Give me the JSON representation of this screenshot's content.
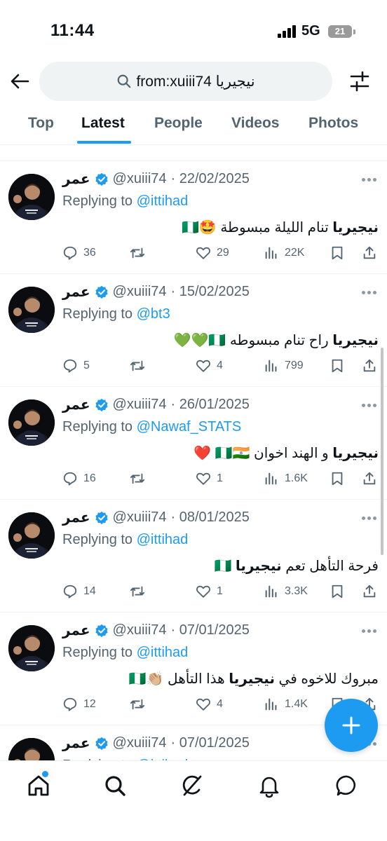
{
  "status_bar": {
    "time": "11:44",
    "network": "5G",
    "battery": "21"
  },
  "search": {
    "query": "from:xuiii74 نيجيريا"
  },
  "tabs": [
    "Top",
    "Latest",
    "People",
    "Videos",
    "Photos"
  ],
  "active_tab": "Latest",
  "colors": {
    "accent": "#1d9bf0",
    "text": "#0f1419",
    "muted": "#536471"
  },
  "tweets": [
    {
      "name": "عمر",
      "handle": "@xuiii74",
      "date": "· 22/02/2025",
      "replying_prefix": "Replying to ",
      "replying_to": "@ittihad",
      "text_bold": "نيجيريا",
      "text_rest": " تنام الليلة مبسوطة 🤩🇳🇬",
      "replies": "36",
      "retweets": "",
      "likes": "29",
      "views": "22K"
    },
    {
      "name": "عمر",
      "handle": "@xuiii74",
      "date": "· 15/02/2025",
      "replying_prefix": "Replying to ",
      "replying_to": "@bt3",
      "text_bold": "نيجيريا",
      "text_rest": " راح تنام مبسوطه 🇳🇬💚💚",
      "replies": "5",
      "retweets": "",
      "likes": "4",
      "views": "799"
    },
    {
      "name": "عمر",
      "handle": "@xuiii74",
      "date": "· 26/01/2025",
      "replying_prefix": "Replying to ",
      "replying_to": "@Nawaf_STATS",
      "text_bold": "نيجيريا",
      "text_rest": " و الهند اخوان 🇳🇬🇮🇳 ❤️",
      "replies": "16",
      "retweets": "",
      "likes": "1",
      "views": "1.6K"
    },
    {
      "name": "عمر",
      "handle": "@xuiii74",
      "date": "· 08/01/2025",
      "replying_prefix": "Replying to ",
      "replying_to": "@ittihad",
      "text_pre": "فرحة التأهل تعم ",
      "text_bold": "نيجيريا",
      "text_rest": " 🇳🇬",
      "replies": "14",
      "retweets": "",
      "likes": "1",
      "views": "3.3K"
    },
    {
      "name": "عمر",
      "handle": "@xuiii74",
      "date": "· 07/01/2025",
      "replying_prefix": "Replying to ",
      "replying_to": "@ittihad",
      "text_pre": "مبروك للاخوه في ",
      "text_bold": "نيجيريا",
      "text_rest": " هذا التأهل 👏🏼🇳🇬",
      "replies": "12",
      "retweets": "",
      "likes": "4",
      "views": "1.4K"
    },
    {
      "name": "عمر",
      "handle": "@xuiii74",
      "date": "· 07/01/2025",
      "replying_prefix": "Replying to ",
      "replying_to": "@ittihad"
    }
  ],
  "bottom_nav": [
    "home-icon",
    "search-icon",
    "grok-icon",
    "notifications-icon",
    "messages-icon"
  ]
}
